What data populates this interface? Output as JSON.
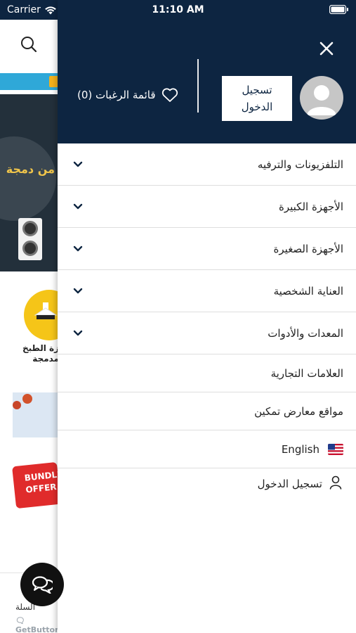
{
  "status_bar": {
    "carrier": "Carrier",
    "time": "11:10 AM"
  },
  "drawer": {
    "login_button": "تسجيل الدخول",
    "wishlist_label": "قائمة الرغبات (0)",
    "menu_items": [
      {
        "label": "التلفزيونات والترفيه",
        "expandable": true
      },
      {
        "label": "الأجهزة الكبيرة",
        "expandable": true
      },
      {
        "label": "الأجهزة الصغيرة",
        "expandable": true
      },
      {
        "label": "العناية الشخصية",
        "expandable": true
      },
      {
        "label": "المعدات والأدوات",
        "expandable": true
      },
      {
        "label": "العلامات التجارية",
        "expandable": false
      },
      {
        "label": "مواقع معارض تمكين",
        "expandable": false
      }
    ],
    "language_label": "English",
    "bottom_login_label": "تسجيل الدخول"
  },
  "background": {
    "banner_text": "من دمجة",
    "category_label": "زة الطبخ مدمجة",
    "bundle_text": "BUNDLE OFFER",
    "nav_label": "السلة",
    "getbutton_label": "GetButton"
  },
  "colors": {
    "header_bg": "#0d2541",
    "accent_cyan": "#2fa8d8",
    "category_yellow": "#f5c518",
    "bundle_red": "#e02b2b"
  }
}
